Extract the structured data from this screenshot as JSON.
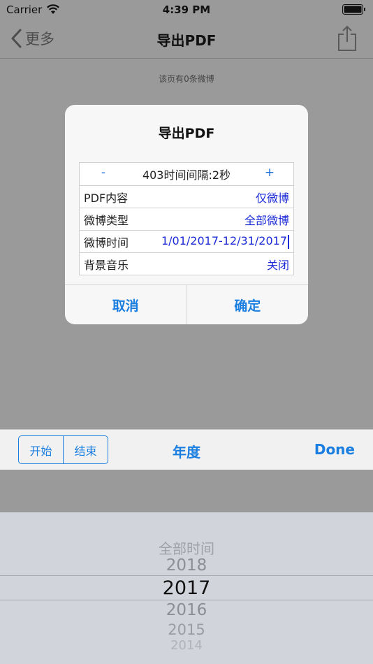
{
  "status_bar": {
    "carrier": "Carrier",
    "time": "4:39 PM"
  },
  "nav": {
    "back_label": "更多",
    "title": "导出PDF"
  },
  "page_note": "该页有0条微博",
  "dialog": {
    "title": "导出PDF",
    "interval": {
      "minus": "-",
      "label": "403时间间隔:2秒",
      "plus": "+"
    },
    "rows": [
      {
        "label": "PDF内容",
        "value": "仅微博"
      },
      {
        "label": "微博类型",
        "value": "全部微博"
      },
      {
        "label": "微博时间",
        "value": "1/01/2017-12/31/2017"
      },
      {
        "label": "背景音乐",
        "value": "关闭"
      }
    ],
    "cancel": "取消",
    "confirm": "确定"
  },
  "toolbar": {
    "segments": [
      "开始",
      "结束"
    ],
    "title": "年度",
    "done": "Done"
  },
  "picker": {
    "options": [
      "全部时间",
      "2018",
      "2017",
      "2016",
      "2015",
      "2014"
    ],
    "selected": "2017"
  },
  "colors": {
    "accent": "#1a7ee0",
    "value_text": "#1b2bd6",
    "dim_background": "#9a9a9a"
  }
}
